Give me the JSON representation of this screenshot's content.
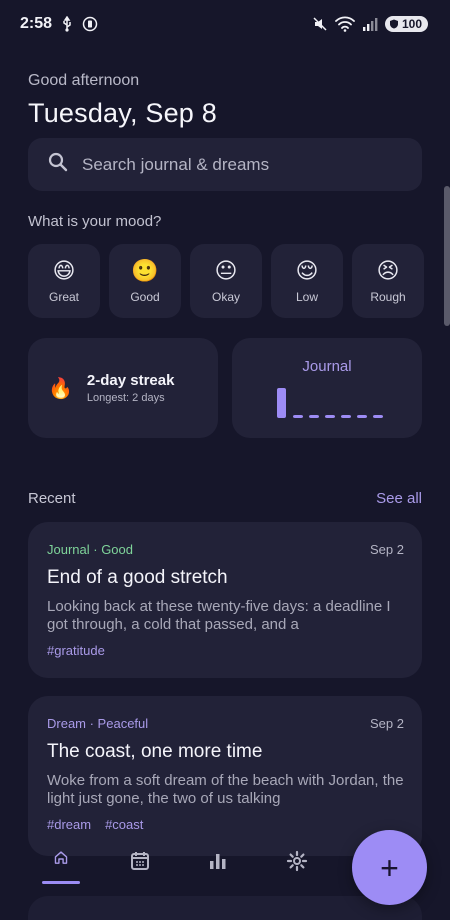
{
  "status_bar": {
    "time": "2:58",
    "battery": "100"
  },
  "header": {
    "greeting": "Good afternoon",
    "date": "Tuesday, Sep 8"
  },
  "search": {
    "placeholder": "Search journal & dreams"
  },
  "mood": {
    "title": "What is your mood?",
    "options": [
      {
        "label": "Great",
        "emoji": "😄"
      },
      {
        "label": "Good",
        "emoji": "🙂"
      },
      {
        "label": "Okay",
        "emoji": "😐"
      },
      {
        "label": "Low",
        "emoji": "😌"
      },
      {
        "label": "Rough",
        "emoji": "😣"
      }
    ]
  },
  "streak": {
    "emoji": "🔥",
    "title": "2-day streak",
    "subtitle": "Longest: 2 days"
  },
  "journal_widget": {
    "label": "Journal",
    "activity": [
      1,
      0,
      0,
      0,
      0,
      0,
      0
    ]
  },
  "recent": {
    "title": "Recent",
    "see_all": "See all",
    "entries": [
      {
        "meta": "Journal · Good",
        "meta_color": "#7fd49a",
        "date": "Sep 2",
        "title": "End of a good stretch",
        "preview": "Looking back at these twenty-five days: a deadline I got through, a cold that passed, and a",
        "tags": [
          "#gratitude"
        ]
      },
      {
        "meta": "Dream · Peaceful",
        "meta_color": "#a99ae8",
        "date": "Sep 2",
        "title": "The coast, one more time",
        "preview": "Woke from a soft dream of the beach with Jordan, the light just gone, the two of us talking",
        "tags": [
          "#dream",
          "#coast"
        ]
      }
    ]
  },
  "nav": {
    "items": [
      "home-icon",
      "calendar-icon",
      "stats-icon",
      "settings-icon"
    ],
    "active": "home-icon"
  },
  "fab": {
    "label": "+"
  },
  "colors": {
    "accent": "#9d8cf5",
    "background": "#16162a",
    "card": "#222238"
  }
}
